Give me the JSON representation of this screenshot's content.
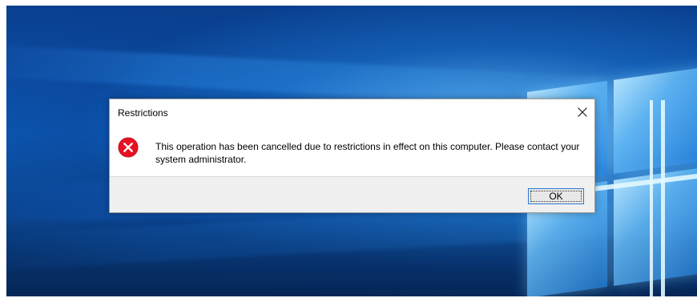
{
  "dialog": {
    "title": "Restrictions",
    "message": "This operation has been cancelled due to restrictions in effect on this computer. Please contact your system administrator.",
    "icon": "error-icon",
    "buttons": {
      "ok_label": "OK"
    }
  },
  "icons": {
    "close": "close-icon",
    "error": "error-icon"
  },
  "colors": {
    "desktop_blue": "#0b4ea8",
    "error_red": "#e81123",
    "button_focus_blue": "#2b79d4",
    "dialog_footer": "#f0f0f0"
  }
}
